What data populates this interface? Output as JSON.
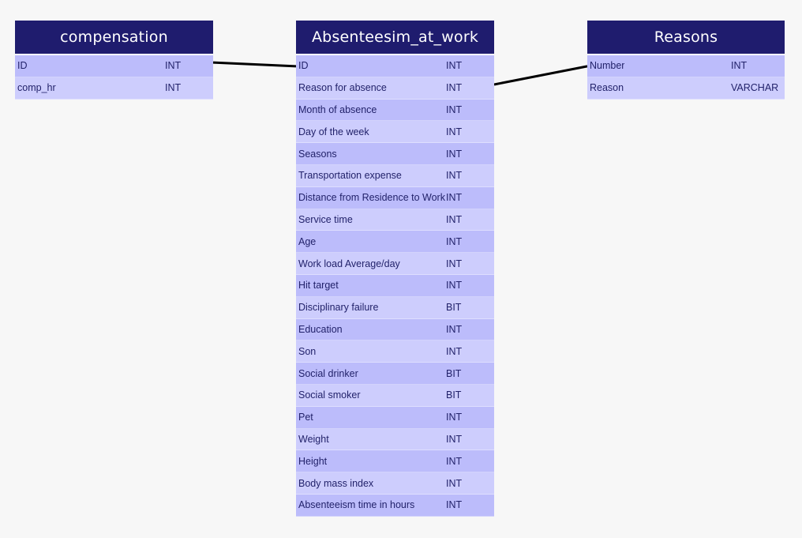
{
  "tables": {
    "compensation": {
      "title": "compensation",
      "columns": [
        {
          "name": "ID",
          "type": "INT"
        },
        {
          "name": "comp_hr",
          "type": "INT"
        }
      ]
    },
    "absenteeism": {
      "title": "Absenteesim_at_work",
      "columns": [
        {
          "name": "ID",
          "type": "INT"
        },
        {
          "name": "Reason for absence",
          "type": "INT"
        },
        {
          "name": "Month of absence",
          "type": "INT"
        },
        {
          "name": "Day of the week",
          "type": "INT"
        },
        {
          "name": "Seasons",
          "type": "INT"
        },
        {
          "name": "Transportation expense",
          "type": "INT"
        },
        {
          "name": "Distance from Residence to Work",
          "type": "INT"
        },
        {
          "name": "Service time",
          "type": "INT"
        },
        {
          "name": "Age",
          "type": "INT"
        },
        {
          "name": "Work load Average/day",
          "type": "INT"
        },
        {
          "name": "Hit target",
          "type": "INT"
        },
        {
          "name": "Disciplinary failure",
          "type": "BIT"
        },
        {
          "name": "Education",
          "type": "INT"
        },
        {
          "name": "Son",
          "type": "INT"
        },
        {
          "name": "Social drinker",
          "type": "BIT"
        },
        {
          "name": "Social smoker",
          "type": "BIT"
        },
        {
          "name": "Pet",
          "type": "INT"
        },
        {
          "name": "Weight",
          "type": "INT"
        },
        {
          "name": "Height",
          "type": "INT"
        },
        {
          "name": "Body mass index",
          "type": "INT"
        },
        {
          "name": "Absenteeism time in hours",
          "type": "INT"
        }
      ]
    },
    "reasons": {
      "title": "Reasons",
      "columns": [
        {
          "name": "Number",
          "type": "INT"
        },
        {
          "name": "Reason",
          "type": "VARCHAR"
        }
      ]
    }
  },
  "relationships": [
    {
      "from_table": "compensation",
      "from_column": "ID",
      "to_table": "absenteeism",
      "to_column": "ID"
    },
    {
      "from_table": "absenteeism",
      "from_column": "Reason for absence",
      "to_table": "reasons",
      "to_column": "Number"
    }
  ],
  "colors": {
    "header": "#1f1c6e",
    "row_odd": "#bcbcfb",
    "row_even": "#cdcdfd",
    "row_text": "#22226a",
    "link": "#000000",
    "background": "#f7f7f7"
  }
}
